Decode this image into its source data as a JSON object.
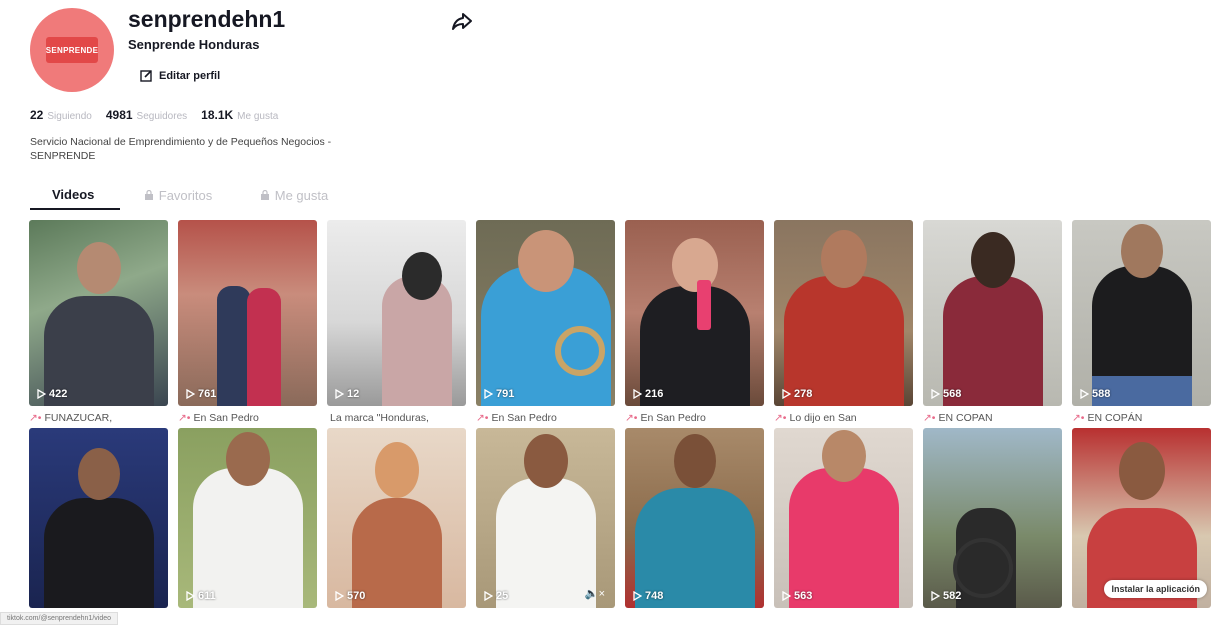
{
  "profile": {
    "username": "senprendehn1",
    "nickname": "Senprende Honduras",
    "avatar_text": "SENPRENDE",
    "edit_label": "Editar perfil",
    "stats": [
      {
        "value": "22",
        "label": "Siguiendo"
      },
      {
        "value": "4981",
        "label": "Seguidores"
      },
      {
        "value": "18.1K",
        "label": "Me gusta"
      }
    ],
    "bio": "Servicio Nacional de Emprendimiento y de Pequeños Negocios - SENPRENDE"
  },
  "tabs": [
    {
      "label": "Videos",
      "active": true
    },
    {
      "label": "Favoritos",
      "active": false
    },
    {
      "label": "Me gusta",
      "active": false
    }
  ],
  "videos_row1": [
    {
      "views": "422",
      "caption": "FUNAZUCAR,",
      "prefix": "↗•"
    },
    {
      "views": "761",
      "caption": "En San Pedro",
      "prefix": "↗•"
    },
    {
      "views": "12",
      "caption": "La marca \"Honduras,",
      "prefix": ""
    },
    {
      "views": "791",
      "caption": "En San Pedro",
      "prefix": "↗•"
    },
    {
      "views": "216",
      "caption": "En San Pedro",
      "prefix": "↗•"
    },
    {
      "views": "278",
      "caption": "Lo dijo en San",
      "prefix": "↗•"
    },
    {
      "views": "568",
      "caption": "EN COPAN",
      "prefix": "↗•"
    },
    {
      "views": "588",
      "caption": "EN COPÁN",
      "prefix": "↗•"
    }
  ],
  "videos_row2": [
    {
      "views": ""
    },
    {
      "views": "611"
    },
    {
      "views": "570"
    },
    {
      "views": "25"
    },
    {
      "views": "748"
    },
    {
      "views": "563"
    },
    {
      "views": "582"
    },
    {
      "views": ""
    }
  ],
  "install_label": "Instalar la aplicación",
  "url_text": "tiktok.com/@senprendehn1/video",
  "colors": {
    "accent": "#fe2c55",
    "avatar_bg": "#f07a7a"
  }
}
